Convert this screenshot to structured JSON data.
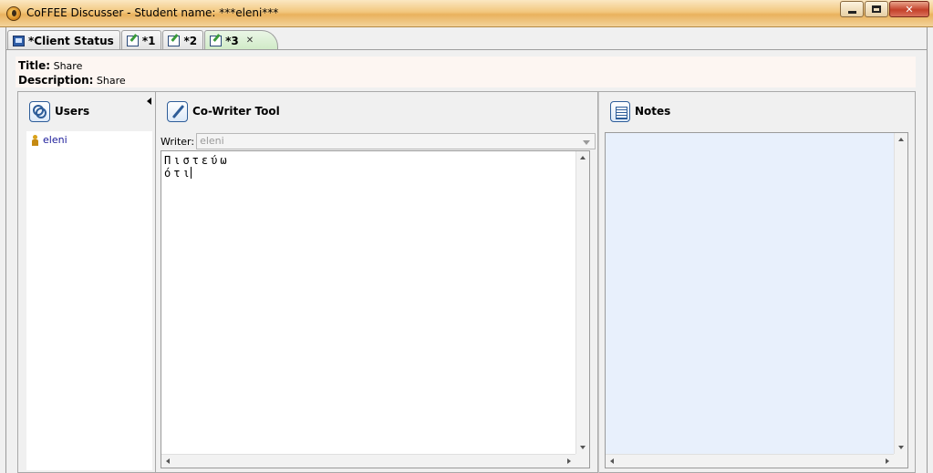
{
  "window": {
    "title": "CoFFEE Discusser - Student name: ***eleni***",
    "app_icon": "coffee-app-icon"
  },
  "tabs": [
    {
      "label": "*Client Status",
      "icon": "monitor-icon",
      "active": false
    },
    {
      "label": "*1",
      "icon": "edit-session-icon",
      "active": false
    },
    {
      "label": "*2",
      "icon": "edit-session-icon",
      "active": false
    },
    {
      "label": "*3",
      "icon": "edit-session-icon",
      "active": true,
      "close": "✕"
    }
  ],
  "info": {
    "title_label": "Title:",
    "title_value": "Share",
    "description_label": "Description:",
    "description_value": "Share"
  },
  "users_panel": {
    "heading": "Users",
    "icon": "users-icon",
    "users": [
      "eleni"
    ]
  },
  "cowriter_panel": {
    "heading": "Co-Writer Tool",
    "icon": "pencil-icon",
    "writer_label": "Writer:",
    "writer_value": "eleni",
    "text": "Πιστεύω ότι"
  },
  "notes_panel": {
    "heading": "Notes",
    "icon": "notepad-icon"
  },
  "colors": {
    "title_bar": "#f2c77e",
    "active_tab": "#cfeac6",
    "notes_background": "#e8f0fc",
    "user_link": "#1a1a99"
  }
}
